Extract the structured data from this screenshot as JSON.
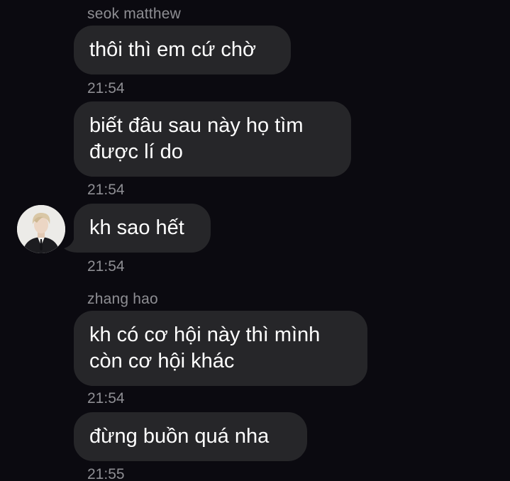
{
  "messages": [
    {
      "sender": "seok matthew",
      "text": "thôi thì em cứ chờ",
      "time": "21:54"
    },
    {
      "text_lines": [
        "biết đâu sau này họ tìm",
        "được lí do"
      ],
      "time": "21:54"
    },
    {
      "text": "kh sao hết",
      "time": "21:54",
      "avatar": "avatar-photo"
    },
    {
      "sender": "zhang hao",
      "text_lines": [
        "kh có cơ hội này thì mình",
        "còn cơ hội khác"
      ],
      "time": "21:54"
    },
    {
      "text": "đừng buồn quá nha",
      "time": "21:55"
    }
  ],
  "colors": {
    "background": "#0b0a10",
    "bubble": "#262629",
    "text": "#ffffff",
    "meta": "#8e8e93"
  }
}
